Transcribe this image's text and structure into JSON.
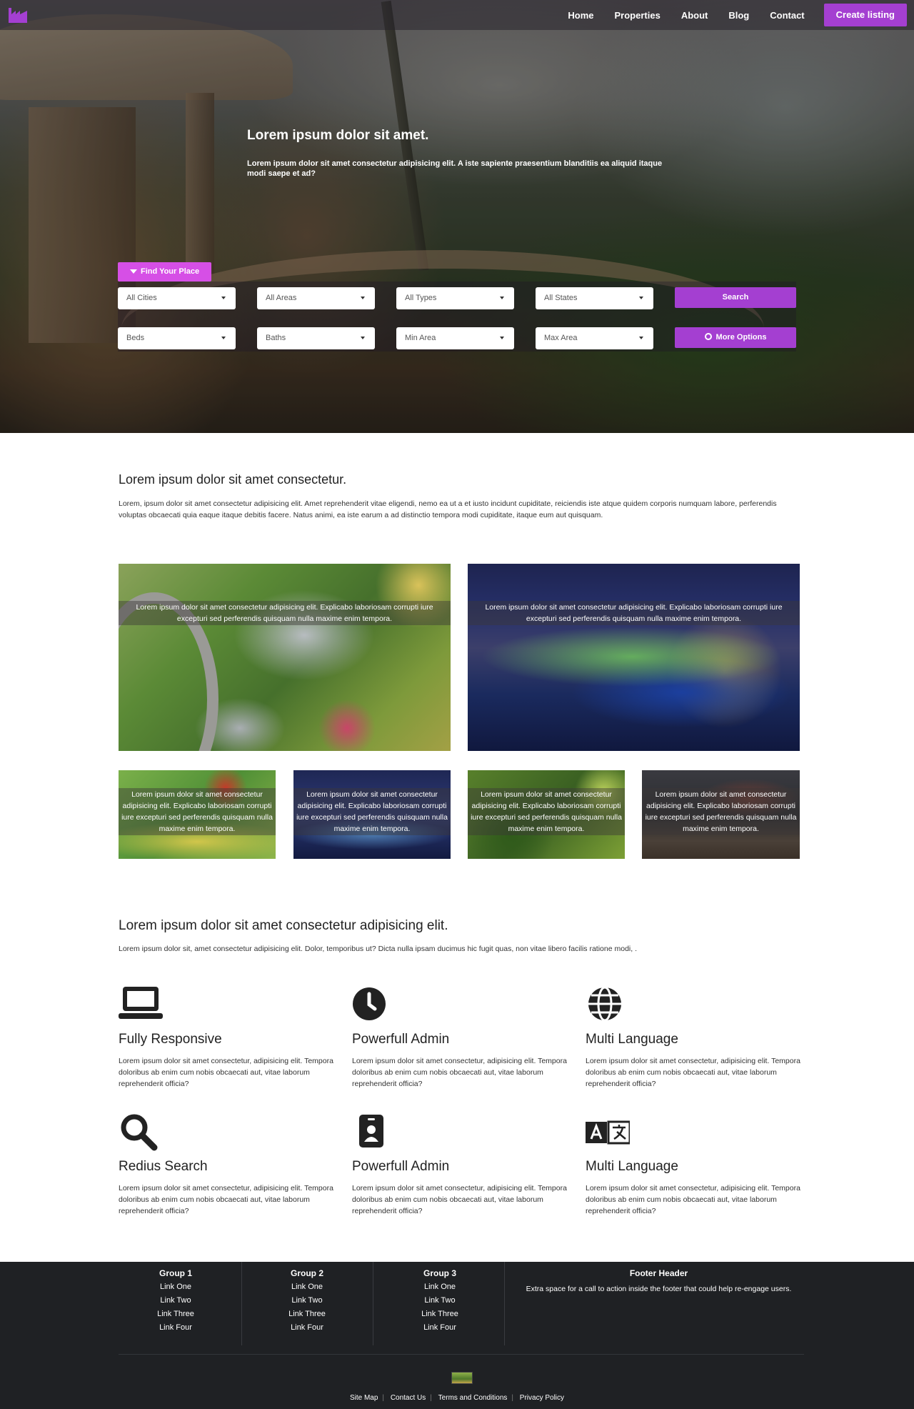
{
  "nav": {
    "links": [
      "Home",
      "Properties",
      "About",
      "Blog",
      "Contact"
    ],
    "cta": "Create listing",
    "accent": "#a43fd1"
  },
  "hero": {
    "title": "Lorem ipsum dolor sit amet.",
    "subtitle": "Lorem ipsum dolor sit amet consectetur adipisicing elit. A iste sapiente praesentium blanditiis ea aliquid itaque modi saepe et ad?",
    "search_tag": "Find Your Place",
    "selects_row1": [
      "All Cities",
      "All Areas",
      "All Types",
      "All States"
    ],
    "selects_row2": [
      "Beds",
      "Baths",
      "Min Area",
      "Max Area"
    ],
    "search_button": "Search",
    "more_button": "More Options"
  },
  "intro": {
    "title": "Lorem ipsum dolor sit amet consectetur.",
    "text": "Lorem, ipsum dolor sit amet consectetur adipisicing elit. Amet reprehenderit vitae eligendi, nemo ea ut a et iusto incidunt cupiditate, reiciendis iste atque quidem corporis numquam labore, perferendis voluptas obcaecati quia eaque itaque debitis facere. Natus animi, ea iste earum a ad distinctio tempora modi cupiditate, itaque eum aut quisquam."
  },
  "gallery": {
    "large_caption": "Lorem ipsum dolor sit amet consectetur adipisicing elit. Explicabo laboriosam corrupti iure excepturi sed perferendis quisquam nulla maxime enim tempora.",
    "small_caption": "Lorem ipsum dolor sit amet consectetur adipisicing elit. Explicabo laboriosam corrupti iure excepturi sed perferendis quisquam nulla maxime enim tempora."
  },
  "features": {
    "title": "Lorem ipsum dolor sit amet consectetur adipisicing elit.",
    "subtitle": "Lorem ipsum dolor sit, amet consectetur adipisicing elit. Dolor, temporibus ut? Dicta nulla ipsam ducimus hic fugit quas, non vitae libero facilis ratione modi, .",
    "items": [
      {
        "icon": "laptop-icon",
        "title": "Fully Responsive",
        "text": "Lorem ipsum dolor sit amet consectetur, adipisicing elit. Tempora doloribus ab enim cum nobis obcaecati aut, vitae laborum reprehenderit officia?"
      },
      {
        "icon": "clock-icon",
        "title": "Powerfull Admin",
        "text": "Lorem ipsum dolor sit amet consectetur, adipisicing elit. Tempora doloribus ab enim cum nobis obcaecati aut, vitae laborum reprehenderit officia?"
      },
      {
        "icon": "globe-icon",
        "title": "Multi Language",
        "text": "Lorem ipsum dolor sit amet consectetur, adipisicing elit. Tempora doloribus ab enim cum nobis obcaecati aut, vitae laborum reprehenderit officia?"
      },
      {
        "icon": "search-icon",
        "title": "Redius Search",
        "text": "Lorem ipsum dolor sit amet consectetur, adipisicing elit. Tempora doloribus ab enim cum nobis obcaecati aut, vitae laborum reprehenderit officia?"
      },
      {
        "icon": "id-badge-icon",
        "title": "Powerfull Admin",
        "text": "Lorem ipsum dolor sit amet consectetur, adipisicing elit. Tempora doloribus ab enim cum nobis obcaecati aut, vitae laborum reprehenderit officia?"
      },
      {
        "icon": "translate-icon",
        "title": "Multi Language",
        "text": "Lorem ipsum dolor sit amet consectetur, adipisicing elit. Tempora doloribus ab enim cum nobis obcaecati aut, vitae laborum reprehenderit officia?"
      }
    ]
  },
  "footer": {
    "groups": [
      {
        "title": "Group 1",
        "links": [
          "Link One",
          "Link Two",
          "Link Three",
          "Link Four"
        ]
      },
      {
        "title": "Group 2",
        "links": [
          "Link One",
          "Link Two",
          "Link Three",
          "Link Four"
        ]
      },
      {
        "title": "Group 3",
        "links": [
          "Link One",
          "Link Two",
          "Link Three",
          "Link Four"
        ]
      }
    ],
    "cta_title": "Footer Header",
    "cta_text": "Extra space for a call to action inside the footer that could help re-engage users.",
    "bottom_links": [
      "Site Map",
      "Contact Us",
      "Terms and Conditions",
      "Privacy Policy"
    ]
  }
}
